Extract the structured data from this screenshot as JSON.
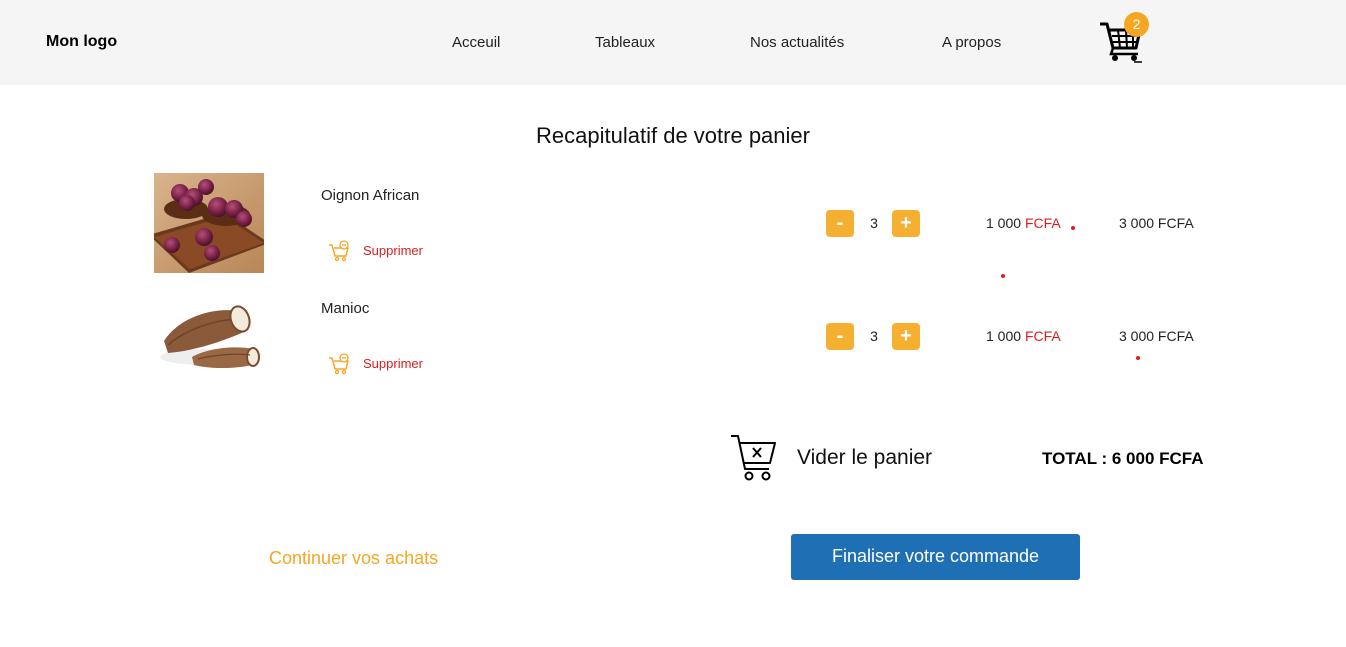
{
  "header": {
    "logo": "Mon logo",
    "nav": [
      "Acceuil",
      "Tableaux",
      "Nos actualités",
      "A propos"
    ],
    "cart_count": "2"
  },
  "page_title": "Recapitulatif de votre panier",
  "items": [
    {
      "name": "Oignon African",
      "delete_label": "Supprimer",
      "quantity": "3",
      "unit_price": "1 000",
      "currency": "FCFA",
      "subtotal": "3 000 FCFA",
      "image": "red-onions-photo"
    },
    {
      "name": "Manioc",
      "delete_label": "Supprimer",
      "quantity": "3",
      "unit_price": "1 000",
      "currency": "FCFA",
      "subtotal": "3 000 FCFA",
      "image": "cassava-photo"
    }
  ],
  "controls": {
    "minus": "-",
    "plus": "+"
  },
  "cart_actions": {
    "empty_label": "Vider le panier",
    "total": "TOTAL : 6 000 FCFA"
  },
  "footer_actions": {
    "continue_label": "Continuer vos achats",
    "checkout_label": "Finaliser votre commande"
  },
  "colors": {
    "accent": "#f5a623",
    "qty_button": "#f5b031",
    "danger": "#e01b1b",
    "primary_button": "#1f6fb5",
    "header_bg": "#f5f5f5"
  },
  "icons": [
    "cart-icon",
    "cart-remove-icon",
    "cart-empty-icon"
  ]
}
